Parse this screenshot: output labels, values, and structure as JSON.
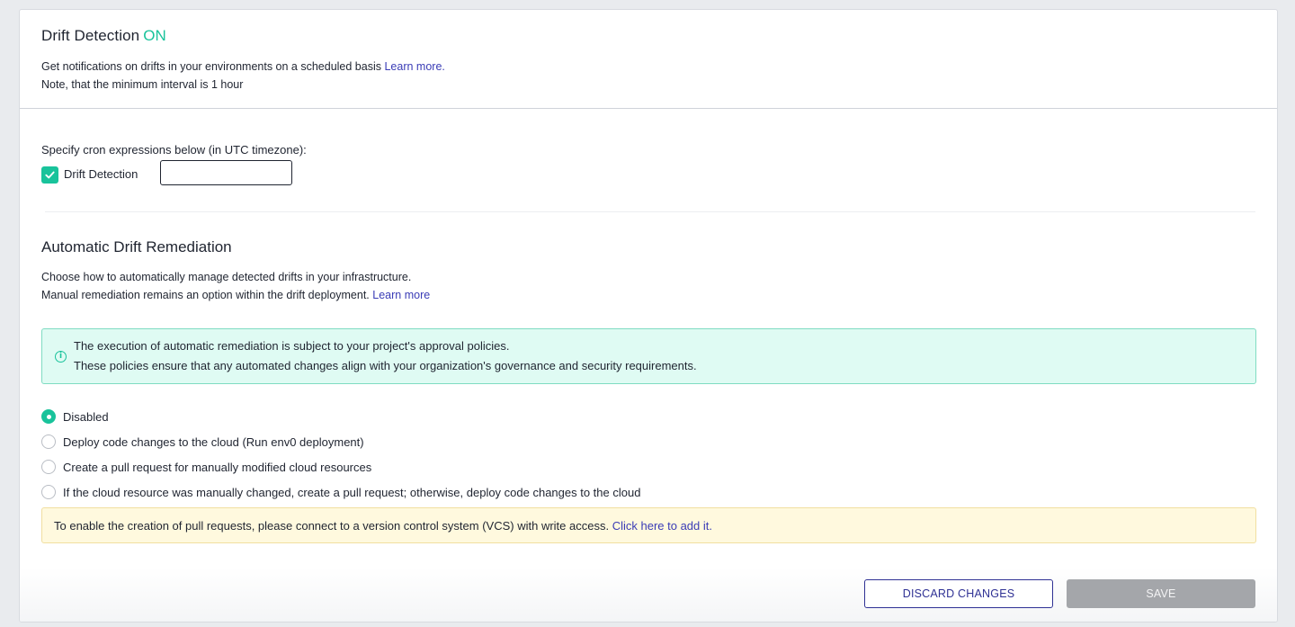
{
  "drift_detection": {
    "title": "Drift Detection",
    "status": "ON",
    "description": "Get notifications on drifts in your environments on a scheduled basis",
    "learn_more": "Learn more.",
    "note": "Note, that the minimum interval is 1 hour"
  },
  "cron": {
    "label": "Specify cron expressions below (in UTC timezone):",
    "checkbox_label": "Drift Detection",
    "checked": true,
    "input_value": ""
  },
  "remediation": {
    "title": "Automatic Drift Remediation",
    "description_line1": "Choose how to automatically manage detected drifts in your infrastructure.",
    "description_line2": "Manual remediation remains an option within the drift deployment.",
    "learn_more": "Learn more",
    "info_line1": "The execution of automatic remediation is subject to your project's approval policies.",
    "info_line2": "These policies ensure that any automated changes align with your organization's governance and security requirements.",
    "options": [
      {
        "label": "Disabled",
        "selected": true
      },
      {
        "label": "Deploy code changes to the cloud (Run env0 deployment)",
        "selected": false
      },
      {
        "label": "Create a pull request for manually modified cloud resources",
        "selected": false
      },
      {
        "label": "If the cloud resource was manually changed, create a pull request; otherwise, deploy code changes to the cloud",
        "selected": false
      }
    ],
    "warning_text": "To enable the creation of pull requests, please connect to a version control system (VCS) with write access.",
    "warning_link": "Click here to add it."
  },
  "actions": {
    "discard_label": "DISCARD CHANGES",
    "save_label": "SAVE"
  },
  "colors": {
    "accent": "#19c39b",
    "link": "#3a3cb6",
    "primary_outline": "#2f3194",
    "info_bg": "#dffbf3",
    "warning_bg": "#fff9de",
    "disabled_button": "#a4a6aa"
  },
  "icons": {
    "checkbox": "check-icon",
    "info": "info-circle-icon"
  }
}
